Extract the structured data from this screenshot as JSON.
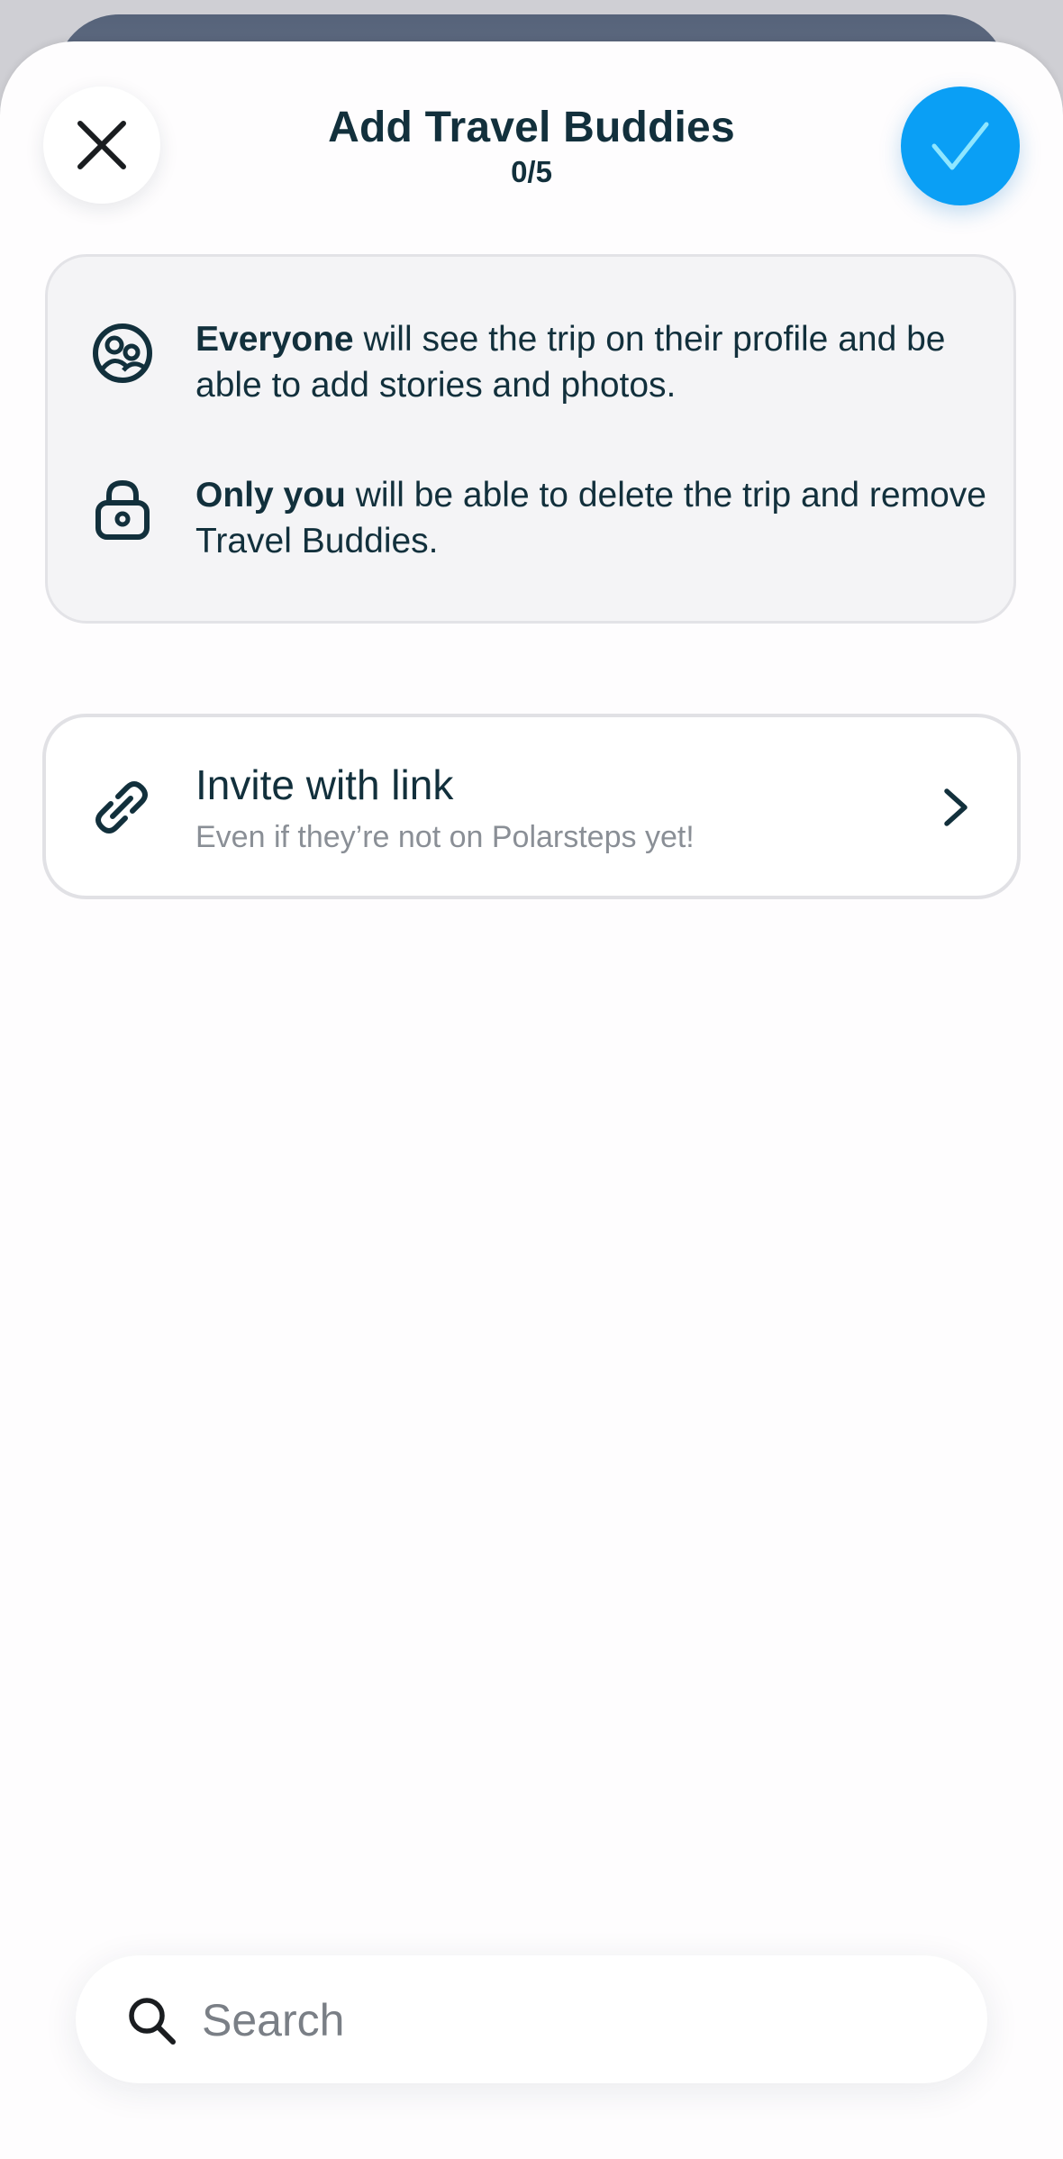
{
  "header": {
    "title": "Add Travel Buddies",
    "counter": "0/5",
    "close_icon": "close-icon",
    "confirm_icon": "checkmark-icon",
    "confirm_color": "#0a9ff5"
  },
  "info": {
    "rows": [
      {
        "icon": "people-circle-icon",
        "bold": "Everyone",
        "rest": " will see the trip on their profile and be able to add stories and photos."
      },
      {
        "icon": "lock-icon",
        "bold": "Only you",
        "rest": " will be able to delete the trip and remove Travel Buddies."
      }
    ]
  },
  "invite": {
    "icon": "link-icon",
    "title": "Invite with link",
    "subtitle": "Even if they’re not on Polarsteps yet!",
    "chevron_icon": "chevron-right-icon"
  },
  "search": {
    "icon": "search-icon",
    "placeholder": "Search",
    "value": ""
  }
}
